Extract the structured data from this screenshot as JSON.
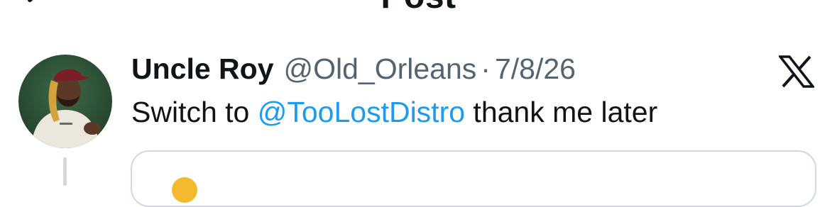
{
  "header": {
    "title": "Post",
    "back_icon": "arrow-left-icon"
  },
  "post": {
    "author": {
      "display_name": "Uncle Roy",
      "handle": "@Old_Orleans"
    },
    "separator": "·",
    "date": "7/8/26",
    "text_before": "Switch to ",
    "mention": "@TooLostDistro",
    "text_after": " thank me later",
    "source_icon": "x-logo-icon"
  },
  "colors": {
    "text": "#0f1419",
    "secondary_text": "#536471",
    "mention": "#1d9bf0",
    "border": "#cfd9de"
  }
}
